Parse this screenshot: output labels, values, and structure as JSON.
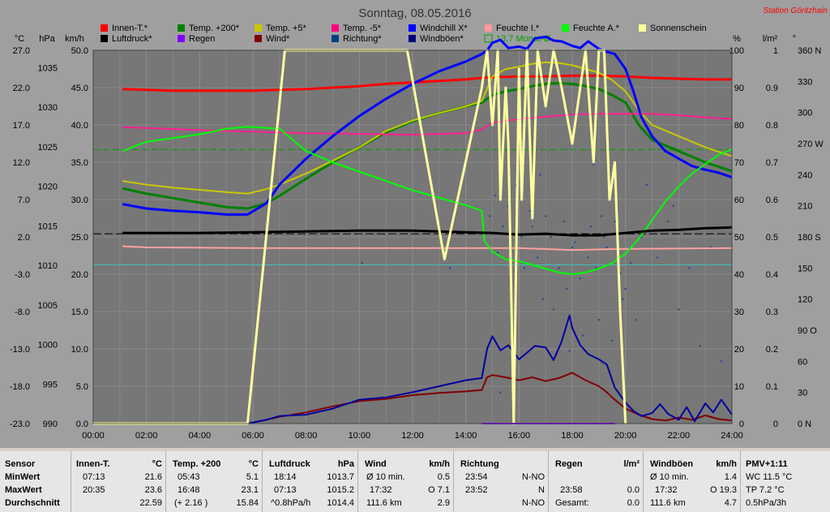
{
  "chart_data": {
    "type": "line",
    "title": "Sonntag, 08.05.2016",
    "station": "Station Göritzhain",
    "xlabels": [
      "00:00",
      "02:00",
      "04:00",
      "06:00",
      "08:00",
      "10:00",
      "12:00",
      "14:00",
      "16:00",
      "18:00",
      "20:00",
      "22:00",
      "24:00"
    ],
    "axes": {
      "temp_c": {
        "unit": "°C",
        "ticks": [
          "27.0",
          "22.0",
          "17.0",
          "12.0",
          "7.0",
          "2.0",
          "-3.0",
          "-8.0",
          "-13.0",
          "-18.0",
          "-23.0"
        ],
        "range": [
          -23,
          27
        ]
      },
      "pressure": {
        "unit": "hPa",
        "ticks": [
          "1035",
          "1030",
          "1025",
          "1020",
          "1015",
          "1010",
          "1005",
          "1000",
          "995",
          "990"
        ],
        "range": [
          990,
          1037.2
        ]
      },
      "wind": {
        "unit": "km/h",
        "ticks": [
          "50.0",
          "45.0",
          "40.0",
          "35.0",
          "30.0",
          "25.0",
          "20.0",
          "15.0",
          "10.0",
          "5.0",
          "0.0"
        ],
        "range": [
          0,
          50
        ]
      },
      "humidity": {
        "unit": "%",
        "ticks": [
          "100",
          "90",
          "80",
          "70",
          "60",
          "50",
          "40",
          "30",
          "20",
          "10",
          "0"
        ],
        "range": [
          0,
          100
        ]
      },
      "rain": {
        "unit": "l/m²",
        "ticks": [
          "1",
          "0.9",
          "0.8",
          "0.7",
          "0.6",
          "0.5",
          "0.4",
          "0.3",
          "0.2",
          "0.1",
          "0"
        ],
        "range": [
          0,
          1
        ]
      },
      "direction": {
        "unit": "°",
        "ticks": [
          "360 N",
          "330",
          "300",
          "270 W",
          "240",
          "210",
          "180 S",
          "150",
          "120",
          "90 O",
          "60",
          "30",
          "0 N"
        ],
        "range": [
          0,
          360
        ]
      }
    },
    "legend": [
      {
        "name": "Innen-T.*",
        "color": "#ff0000"
      },
      {
        "name": "Temp. +200*",
        "color": "#008000"
      },
      {
        "name": "Temp. +5*",
        "color": "#c8c800"
      },
      {
        "name": "Temp. -5*",
        "color": "#ff0080"
      },
      {
        "name": "Windchill X*",
        "color": "#0000ff"
      },
      {
        "name": "Feuchte I.*",
        "color": "#ff9999"
      },
      {
        "name": "Feuchte A.*",
        "color": "#00ff00"
      },
      {
        "name": "Sonnenschein",
        "color": "#ffff99"
      },
      {
        "name": "Luftdruck*",
        "color": "#000000"
      },
      {
        "name": "Regen",
        "color": "#8000ff"
      },
      {
        "name": "Wind*",
        "color": "#800000"
      },
      {
        "name": "Richtung*",
        "color": "#004080"
      },
      {
        "name": "Windböen*",
        "color": "#000080"
      },
      {
        "name": "13,7 Monat-Ø",
        "color": "#00a000"
      }
    ],
    "series": [
      {
        "name": "Innen-T.*",
        "axis": "temp_c",
        "color": "#ff0000",
        "width": 3,
        "x": [
          1.1,
          2,
          3,
          4,
          5,
          6,
          7,
          8,
          9,
          10,
          11,
          12,
          13,
          14,
          14.6,
          15,
          16,
          17,
          18,
          19,
          20,
          21,
          22,
          23,
          24
        ],
        "y": [
          21.8,
          21.7,
          21.6,
          21.6,
          21.6,
          21.6,
          21.7,
          21.8,
          22,
          22.2,
          22.5,
          22.7,
          22.9,
          23.1,
          23.3,
          23.4,
          23.5,
          23.5,
          23.6,
          23.6,
          23.5,
          23.3,
          23.2,
          23.1,
          23.1
        ]
      },
      {
        "name": "Temp. +200*",
        "axis": "temp_c",
        "color": "#008000",
        "width": 3,
        "x": [
          1.1,
          2,
          3,
          4,
          5,
          5.8,
          6.5,
          7,
          8,
          9,
          10,
          11,
          12,
          13,
          14,
          14.6,
          15,
          15.5,
          16,
          16.5,
          17,
          17.5,
          18,
          18.5,
          19,
          19.5,
          20,
          20.5,
          21,
          22,
          23,
          24
        ],
        "y": [
          8.5,
          7.8,
          7.2,
          6.6,
          6,
          5.8,
          6.5,
          7.5,
          9.8,
          12,
          14,
          16,
          17.5,
          18.6,
          19.5,
          20,
          21,
          21.5,
          21.8,
          22.2,
          22.5,
          22.6,
          22.5,
          22.2,
          21.8,
          21,
          20,
          17,
          15,
          13.5,
          12,
          10.8
        ]
      },
      {
        "name": "Temp. +5*",
        "axis": "temp_c",
        "color": "#c8c800",
        "width": 2,
        "x": [
          1.1,
          2,
          3,
          4,
          5,
          5.8,
          6.5,
          7,
          8,
          9,
          10,
          11,
          12,
          13,
          14,
          14.6,
          15,
          15.5,
          16,
          16.5,
          17,
          17.5,
          18,
          18.5,
          19,
          19.5,
          20,
          20.5,
          21,
          22,
          23,
          24
        ],
        "y": [
          9.5,
          9,
          8.6,
          8.3,
          8,
          7.8,
          8.4,
          9,
          10.5,
          12.2,
          14,
          16.2,
          17.6,
          18.6,
          19.5,
          20.2,
          23.5,
          24.5,
          24.8,
          25.2,
          25.4,
          25.3,
          25,
          24.5,
          24,
          23,
          21.5,
          19,
          17,
          15.5,
          14,
          12.8
        ]
      },
      {
        "name": "Temp. -5*",
        "axis": "temp_c",
        "color": "#ff2090",
        "width": 2,
        "x": [
          1.1,
          2,
          4,
          6,
          8,
          10,
          12,
          14,
          14.6,
          15,
          16,
          17,
          18,
          19,
          20,
          21,
          22,
          23,
          24
        ],
        "y": [
          16.7,
          16.6,
          16.3,
          16.1,
          15.9,
          15.8,
          15.7,
          15.9,
          16.4,
          17.3,
          17.8,
          18.1,
          18.4,
          18.5,
          18.5,
          18.5,
          18.3,
          18,
          17.8
        ]
      },
      {
        "name": "Windchill X*",
        "axis": "temp_c",
        "color": "#0000ff",
        "width": 3,
        "x": [
          1.1,
          2,
          3,
          4,
          5,
          5.8,
          6.5,
          7,
          8,
          9,
          10,
          11,
          12,
          13,
          14,
          14.6,
          14.8,
          15,
          15.3,
          15.6,
          16,
          16.3,
          16.6,
          17,
          17.3,
          17.6,
          18,
          18.3,
          18.6,
          19,
          19.3,
          19.6,
          20,
          20.3,
          20.6,
          21,
          21.5,
          22,
          22.5,
          23,
          23.5,
          24
        ],
        "y": [
          6.4,
          5.8,
          5.5,
          5.3,
          5,
          5,
          6.5,
          9,
          12.5,
          15.5,
          18.2,
          20.5,
          22.5,
          24.2,
          25.5,
          26.5,
          27,
          28,
          28.4,
          27.3,
          27.5,
          27.2,
          28.6,
          28.8,
          28.3,
          28.2,
          27.6,
          27.3,
          28.2,
          27.2,
          26.8,
          26.5,
          24.5,
          21.5,
          18,
          15.5,
          13.5,
          12.5,
          11.5,
          11,
          10.6,
          10
        ]
      },
      {
        "name": "Feuchte I.*",
        "axis": "humidity",
        "color": "#ffa0a0",
        "width": 2,
        "x": [
          1.1,
          2,
          4,
          6,
          8,
          10,
          12,
          14,
          16,
          18,
          20,
          22,
          24
        ],
        "y": [
          47.5,
          47.2,
          47.1,
          47,
          47,
          47,
          47,
          47,
          47,
          46.5,
          46.8,
          46.9,
          47
        ]
      },
      {
        "name": "Feuchte A.*",
        "axis": "humidity",
        "color": "#00ff00",
        "width": 2,
        "x": [
          1.1,
          2,
          3,
          4,
          5,
          5.8,
          7,
          8,
          9,
          10,
          11,
          12,
          13,
          14,
          14.6,
          14.7,
          15,
          15.5,
          16,
          16.5,
          17,
          17.5,
          18,
          18.5,
          19,
          19.5,
          20,
          20.5,
          21,
          21.5,
          22,
          22.5,
          23,
          23.5,
          24
        ],
        "y": [
          73,
          75.5,
          76.5,
          77.5,
          79,
          79.5,
          79,
          73,
          70,
          67.5,
          65,
          62.5,
          60.5,
          58.5,
          57,
          49,
          46,
          44,
          43.5,
          42.5,
          41.5,
          40.5,
          40,
          40.5,
          41.5,
          43,
          45.5,
          49.5,
          54.5,
          59.5,
          63.5,
          67,
          69.5,
          72,
          73.5
        ]
      },
      {
        "name": "Luftdruck*",
        "axis": "pressure",
        "color": "#000000",
        "width": 3,
        "x": [
          1.1,
          2,
          4,
          6,
          8,
          10,
          12,
          14,
          15,
          16,
          17,
          18,
          19,
          20,
          21,
          22,
          23,
          24
        ],
        "y": [
          1014.1,
          1014.1,
          1014.1,
          1014.2,
          1014.3,
          1014.4,
          1014.4,
          1014.2,
          1014.1,
          1013.9,
          1014.0,
          1013.8,
          1013.8,
          1014.1,
          1014.4,
          1014.5,
          1014.7,
          1014.8
        ]
      },
      {
        "name": "Wind*",
        "axis": "wind",
        "color": "#800000",
        "width": 2,
        "x": [
          5.8,
          6.5,
          7,
          8,
          9,
          10,
          11,
          12,
          13,
          14,
          14.6,
          14.8,
          15,
          15.5,
          16,
          16.5,
          17,
          17.5,
          18,
          18.5,
          19,
          19.3,
          19.5,
          20,
          20.5,
          21,
          21.5,
          22,
          22.5,
          23,
          23.5,
          24
        ],
        "y": [
          0,
          0.5,
          0.9,
          1.5,
          2.3,
          3,
          3.3,
          3.8,
          4.1,
          4.3,
          4.5,
          6.2,
          6.5,
          6.2,
          5.8,
          6.2,
          5.7,
          6.1,
          6.8,
          5.8,
          5,
          4.2,
          3.5,
          2,
          1.2,
          0.6,
          0.4,
          0.8,
          0.5,
          1.1,
          0.6,
          0.4
        ]
      },
      {
        "name": "Windböen*",
        "axis": "wind",
        "color": "#0000a0",
        "width": 2,
        "x": [
          5.8,
          6.5,
          7,
          8,
          9,
          10,
          11,
          12,
          13,
          14,
          14.6,
          14.8,
          15,
          15.3,
          15.6,
          16,
          16.3,
          16.6,
          17,
          17.3,
          17.6,
          17.9,
          18,
          18.3,
          18.6,
          19,
          19.3,
          19.6,
          20,
          20.3,
          20.6,
          21,
          21.3,
          21.6,
          22,
          22.3,
          22.6,
          23,
          23.3,
          23.6,
          24
        ],
        "y": [
          0,
          0.5,
          1,
          1.2,
          2,
          3.2,
          3.5,
          4.2,
          5,
          5.8,
          6.1,
          10,
          11.7,
          9.8,
          10.5,
          8.6,
          9.5,
          10.4,
          10.2,
          8.5,
          11,
          14.5,
          12.8,
          10.5,
          9.3,
          8.6,
          7.9,
          4.8,
          2.8,
          1.7,
          1,
          1.4,
          2.6,
          1.3,
          0.5,
          2.2,
          0.3,
          2.7,
          1.5,
          3.2,
          1.2
        ]
      },
      {
        "name": "Sonnenschein",
        "axis": "humidity",
        "color": "#ffffa0",
        "width": 3,
        "x": [
          0,
          5.8,
          7.2,
          11.8,
          13.2,
          14.6,
          14.8,
          15,
          15.2,
          15.3,
          15.5,
          15.6,
          15.8,
          16,
          16.1,
          16.3,
          16.5,
          16.7,
          17,
          17.3,
          17.6,
          18,
          18.5,
          18.8,
          19,
          19.2,
          19.4,
          19.6,
          19.8,
          20
        ],
        "y": [
          0,
          0,
          100,
          100,
          44,
          90,
          100,
          80,
          100,
          60,
          90,
          75,
          0,
          95,
          60,
          100,
          55,
          100,
          85,
          100,
          90,
          75,
          100,
          70,
          100,
          100,
          60,
          70,
          30,
          0
        ]
      },
      {
        "name": "Regen",
        "axis": "rain",
        "color": "#8000ff",
        "width": 2,
        "x": [
          14.6,
          19.6
        ],
        "y": [
          0,
          0
        ]
      }
    ],
    "richtung_dots": {
      "axis": "direction",
      "color": "#1a4d99",
      "x": [
        14.9,
        15.1,
        15.2,
        15.4,
        15.6,
        15.7,
        15.9,
        16.1,
        16.2,
        16.4,
        16.5,
        16.7,
        16.9,
        17,
        17.2,
        17.3,
        17.5,
        17.7,
        17.8,
        18,
        18.1,
        18.3,
        18.4,
        18.6,
        18.7,
        18.9,
        19,
        19.2,
        19.3,
        19.5,
        19.6,
        19.8,
        20,
        20.2,
        20.4,
        20.6,
        20.8,
        21.2,
        21.6,
        22,
        22.4,
        22.8,
        23.2,
        23.6,
        16.8,
        18.8,
        19.9,
        21.8,
        10.1,
        13.4,
        19.1,
        17.9,
        15.3,
        22.2
      ],
      "y": [
        200,
        220,
        165,
        190,
        210,
        140,
        230,
        180,
        150,
        205,
        190,
        160,
        120,
        200,
        180,
        110,
        150,
        195,
        130,
        170,
        175,
        140,
        85,
        160,
        190,
        150,
        100,
        180,
        170,
        80,
        195,
        145,
        130,
        155,
        100,
        180,
        230,
        160,
        195,
        110,
        150,
        75,
        170,
        60,
        240,
        250,
        120,
        210,
        155,
        150,
        200,
        70,
        30,
        260
      ]
    },
    "ref_lines": [
      {
        "name": "13,7 Monat-Ø",
        "axis": "temp_c",
        "value": 13.7,
        "color": "#00a000",
        "dash": "8,4"
      },
      {
        "name": "Luftdruck-Ref",
        "axis": "pressure",
        "value": 1014.0,
        "color": "#000000",
        "dash": "10,4"
      },
      {
        "name": "Feuchte-Ref",
        "axis": "humidity",
        "value": 42.5,
        "color": "#40c0c0",
        "dash": ""
      }
    ]
  },
  "table": {
    "col1": {
      "header": "Sensor",
      "rows": [
        "MinWert",
        "MaxWert",
        "Durchschnitt"
      ]
    },
    "col2": {
      "header": "Innen-T.",
      "unit": "°C",
      "min_time": "07:13",
      "min_val": "21.6",
      "max_time": "20:35",
      "max_val": "23.6",
      "avg_val": "22.59"
    },
    "col3": {
      "header": "Temp. +200",
      "unit": "°C",
      "min_time": "05:43",
      "min_val": "5.1",
      "max_time": "16:48",
      "max_val": "23.1",
      "avg_extra": "(+ 2.16 )",
      "avg_val": "15.84"
    },
    "col4": {
      "header": "Luftdruck",
      "unit": "hPa",
      "min_time": "18:14",
      "min_val": "1013.7",
      "max_time": "07:13",
      "max_val": "1015.2",
      "avg_extra": "^0.8hPa/h",
      "avg_val": "1014.4"
    },
    "col5": {
      "header": "Wind",
      "unit": "km/h",
      "r1_label": "Ø 10 min.",
      "r1_val": "0.5",
      "r2_label": "17:32",
      "r2_val": "O 7.1",
      "r3_label": "111.6 km",
      "r3_val": "2.9"
    },
    "col6": {
      "header": "Richtung",
      "r1_label": "23:54",
      "r1_val": "N-NO",
      "r2_label": "23:52",
      "r2_val": "N",
      "r3_val": "N-NO"
    },
    "col7": {
      "header": "Regen",
      "unit": "l/m²",
      "r2_label": "23:58",
      "r2_val": "0.0",
      "r3_label": "Gesamt:",
      "r3_val": "0.0"
    },
    "col8": {
      "header": "Windböen",
      "unit": "km/h",
      "r1_label": "Ø 10 min.",
      "r1_val": "1.4",
      "r2_label": "17:32",
      "r2_val": "O 19.3",
      "r3_label": "111.6 km",
      "r3_val": "4.7"
    },
    "col9": {
      "header": "PMV+1:11",
      "r1": "WC 11.5 °C",
      "r2": "TP 7.2 °C",
      "r3": "0.5hPa/3h"
    }
  }
}
